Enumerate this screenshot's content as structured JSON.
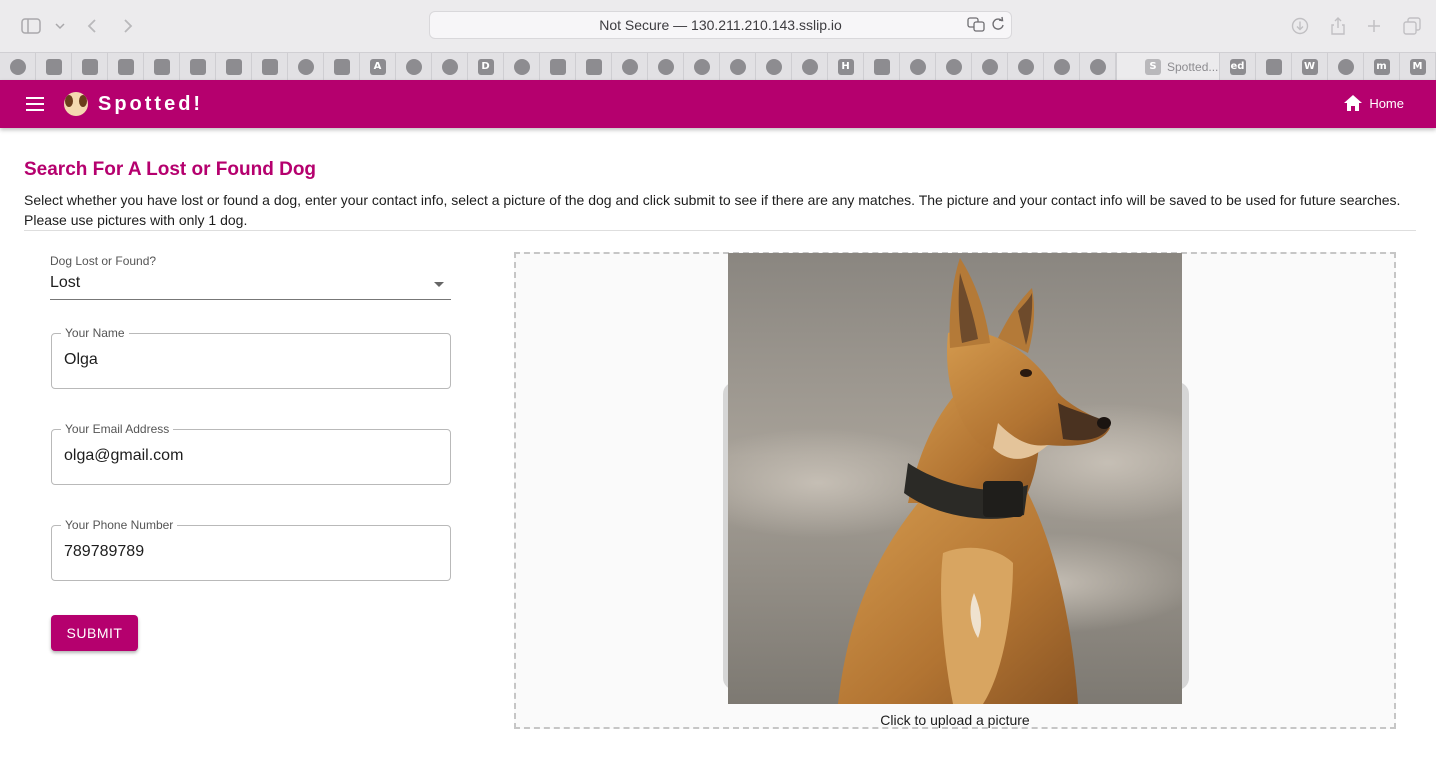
{
  "browser": {
    "address": "Not Secure — 130.211.210.143.sslip.io",
    "tab_title": "Spotted...",
    "icons": [
      "sidebar-icon",
      "chevron-down-icon",
      "back-icon",
      "forward-icon",
      "translate-icon",
      "reload-icon",
      "download-icon",
      "share-icon",
      "new-tab-icon",
      "tabs-overview-icon"
    ],
    "favorites_left": [
      "gear",
      "arrow",
      "shield",
      "link",
      "shirt",
      "list",
      "python",
      "shirt",
      "gear",
      "shield",
      "A",
      "circle",
      "react",
      "D",
      "react",
      "grid",
      "link",
      "drive",
      "hex",
      "react",
      "bolt",
      "circle",
      "ring",
      "H",
      "wave",
      "github",
      "github",
      "hex",
      "hex",
      "circle",
      "hex"
    ],
    "favorites_right": [
      "ed",
      "qr",
      "W",
      "react",
      "m",
      "M"
    ],
    "favorite_letters": {
      "A": "A",
      "D": "D",
      "H": "H",
      "W": "W",
      "ed": "ed",
      "M": "M",
      "m": "m",
      "S": "S"
    }
  },
  "app": {
    "title": "Spotted!",
    "home_label": "Home",
    "brand_color": "#b5006e"
  },
  "main": {
    "heading": "Search For A Lost or Found Dog",
    "intro": "Select whether you have lost or found a dog, enter your contact info, select a picture of the dog and click submit to see if there are any matches. The picture and your contact info will be saved to be used for future searches. Please use pictures with only 1 dog."
  },
  "form": {
    "status": {
      "label": "Dog Lost or Found?",
      "value": "Lost"
    },
    "name": {
      "label": "Your Name",
      "value": "Olga"
    },
    "email": {
      "label": "Your Email Address",
      "value": "olga@gmail.com"
    },
    "phone": {
      "label": "Your Phone Number",
      "value": "789789789"
    },
    "submit_label": "SUBMIT"
  },
  "upload": {
    "caption": "Click to upload a picture"
  }
}
